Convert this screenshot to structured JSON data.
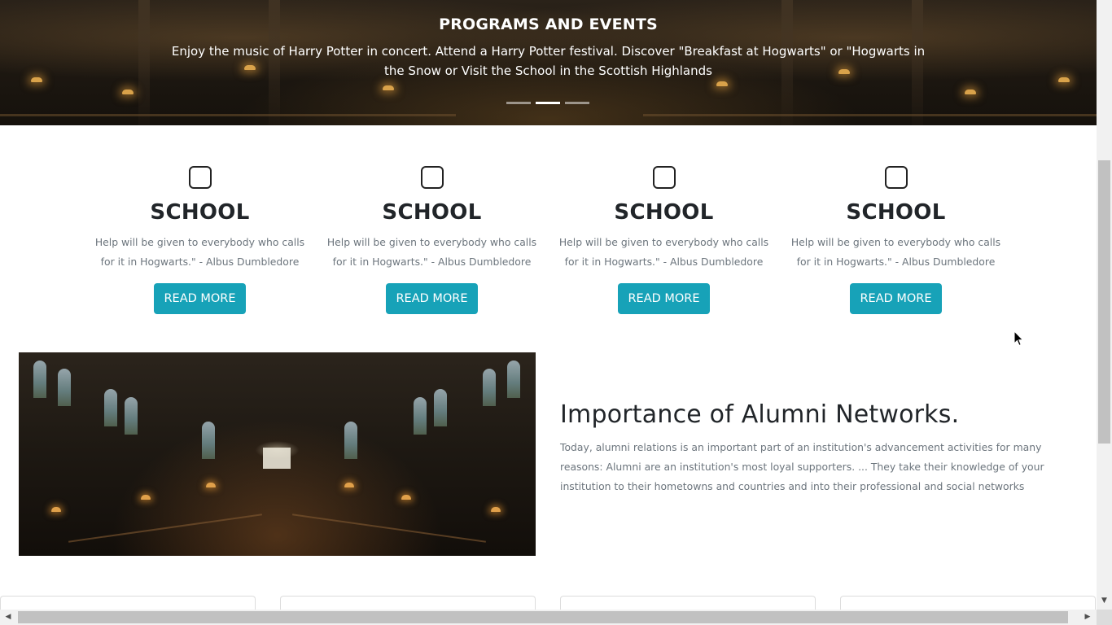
{
  "hero": {
    "title": "PROGRAMS AND EVENTS",
    "text": "Enjoy the music of Harry Potter in concert. Attend a Harry Potter festival. Discover \"Breakfast at Hogwarts\" or \"Hogwarts in the Snow or Visit the School in the Scottish Highlands",
    "slides": 3,
    "active_slide": 2
  },
  "features": [
    {
      "icon": "square-icon",
      "title": "SCHOOL",
      "text": "Help will be given to everybody who calls for it in Hogwarts.\" - Albus Dumbledore",
      "button": "READ MORE"
    },
    {
      "icon": "square-icon",
      "title": "SCHOOL",
      "text": "Help will be given to everybody who calls for it in Hogwarts.\" - Albus Dumbledore",
      "button": "READ MORE"
    },
    {
      "icon": "square-icon",
      "title": "SCHOOL",
      "text": "Help will be given to everybody who calls for it in Hogwarts.\" - Albus Dumbledore",
      "button": "READ MORE"
    },
    {
      "icon": "square-icon",
      "title": "SCHOOL",
      "text": "Help will be given to everybody who calls for it in Hogwarts.\" - Albus Dumbledore",
      "button": "READ MORE"
    }
  ],
  "alumni": {
    "title": "Importance of Alumni Networks.",
    "text": "Today, alumni relations is an important part of an institution's advancement activities for many reasons: Alumni are an institution's most loyal supporters. ... They take their knowledge of your institution to their hometowns and countries and into their professional and social networks"
  },
  "colors": {
    "button": "#17a2b8",
    "heading": "#212529",
    "muted": "#6c757d"
  }
}
